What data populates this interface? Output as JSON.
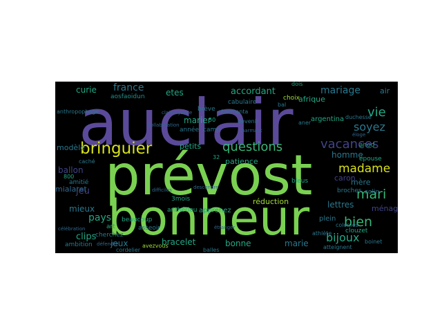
{
  "colors": {
    "background": "#000000",
    "page": "#ffffff",
    "palette": [
      "#5b4a9a",
      "#7ad151",
      "#d8e219",
      "#2a788e",
      "#22a884",
      "#414487",
      "#35b779",
      "#31688e",
      "#440154",
      "#3b528b",
      "#21918c",
      "#a0da39",
      "#fde725",
      "#482878"
    ]
  },
  "words": [
    {
      "text": "auclair",
      "color": "#5b4a9a"
    },
    {
      "text": "prévost",
      "color": "#7ad151"
    },
    {
      "text": "bonheur",
      "color": "#7ad151"
    },
    {
      "text": "bringuier",
      "color": "#d8e219"
    },
    {
      "text": "questions",
      "color": "#35b779"
    },
    {
      "text": "vacances",
      "color": "#414487"
    },
    {
      "text": "madame",
      "color": "#d8e219"
    },
    {
      "text": "mari",
      "color": "#35b779"
    },
    {
      "text": "bien",
      "color": "#35b779"
    },
    {
      "text": "bijoux",
      "color": "#22a884"
    },
    {
      "text": "vie",
      "color": "#22a884"
    },
    {
      "text": "soyez",
      "color": "#2a788e"
    },
    {
      "text": "mariage",
      "color": "#2a788e"
    },
    {
      "text": "france",
      "color": "#2a788e"
    },
    {
      "text": "accordant",
      "color": "#22a884"
    },
    {
      "text": "curie",
      "color": "#22a884"
    },
    {
      "text": "etes",
      "color": "#22a884"
    },
    {
      "text": "marier",
      "color": "#22a884"
    },
    {
      "text": "pays",
      "color": "#22a884"
    },
    {
      "text": "mieux",
      "color": "#2a788e"
    },
    {
      "text": "jeu",
      "color": "#414487"
    },
    {
      "text": "ballon",
      "color": "#414487"
    },
    {
      "text": "clips",
      "color": "#22a884"
    },
    {
      "text": "jeux",
      "color": "#2a788e"
    },
    {
      "text": "bracelet",
      "color": "#22a884"
    },
    {
      "text": "bonne",
      "color": "#22a884"
    },
    {
      "text": "marie",
      "color": "#2a788e"
    },
    {
      "text": "lettres",
      "color": "#2a788e"
    },
    {
      "text": "homme",
      "color": "#2a788e"
    },
    {
      "text": "caron",
      "color": "#414487"
    },
    {
      "text": "mère",
      "color": "#2a788e"
    },
    {
      "text": "ménage",
      "color": "#414487"
    },
    {
      "text": "mialaret",
      "color": "#31688e"
    },
    {
      "text": "modèle",
      "color": "#2a788e"
    },
    {
      "text": "petits",
      "color": "#22a884"
    },
    {
      "text": "patience",
      "color": "#22a884"
    },
    {
      "text": "réduction",
      "color": "#a0da39"
    },
    {
      "text": "apprenez",
      "color": "#22a884"
    },
    {
      "text": "plein",
      "color": "#2a788e"
    },
    {
      "text": "argentina",
      "color": "#22a884"
    },
    {
      "text": "afrique",
      "color": "#22a884"
    },
    {
      "text": "air",
      "color": "#2a788e"
    },
    {
      "text": "aosfaoidun",
      "color": "#21918c"
    },
    {
      "text": "choix",
      "color": "#a0da39"
    },
    {
      "text": "anod",
      "color": "#22a884"
    },
    {
      "text": "épouse",
      "color": "#22a884"
    },
    {
      "text": "art",
      "color": "#22a884"
    },
    {
      "text": "ambition",
      "color": "#2a788e"
    },
    {
      "text": "amitié",
      "color": "#2a788e"
    },
    {
      "text": "3mois",
      "color": "#22a884"
    },
    {
      "text": "anthérieu",
      "color": "#22a884"
    },
    {
      "text": "beaucoup",
      "color": "#22a884"
    },
    {
      "text": "année",
      "color": "#2a788e"
    },
    {
      "text": "camp",
      "color": "#2a788e"
    },
    {
      "text": "brève",
      "color": "#2a788e"
    },
    {
      "text": "cabulaire",
      "color": "#2a788e"
    },
    {
      "text": "bleus",
      "color": "#22a884"
    },
    {
      "text": "broches",
      "color": "#2a788e"
    },
    {
      "text": "clouzet",
      "color": "#22a884"
    },
    {
      "text": "colin",
      "color": "#2a788e"
    },
    {
      "text": "cherchez",
      "color": "#2a788e"
    },
    {
      "text": "asseoir",
      "color": "#2a788e"
    },
    {
      "text": "avezvous",
      "color": "#a0da39"
    },
    {
      "text": "balles",
      "color": "#2a788e"
    },
    {
      "text": "cordelier",
      "color": "#2a788e"
    },
    {
      "text": "atteignent",
      "color": "#2a788e"
    },
    {
      "text": "boinet",
      "color": "#2a788e"
    },
    {
      "text": "athlète",
      "color": "#2a788e"
    },
    {
      "text": "50",
      "color": "#22a884"
    },
    {
      "text": "32",
      "color": "#22a884"
    },
    {
      "text": "800",
      "color": "#22a884"
    },
    {
      "text": "anthropophage",
      "color": "#2a788e"
    },
    {
      "text": "charmanta",
      "color": "#2a788e"
    },
    {
      "text": "dois",
      "color": "#22a884"
    },
    {
      "text": "bal",
      "color": "#2a788e"
    },
    {
      "text": "devenir",
      "color": "#2a788e"
    },
    {
      "text": "aner",
      "color": "#2a788e"
    },
    {
      "text": "colonies",
      "color": "#2a788e"
    },
    {
      "text": "duchesse",
      "color": "#2a788e"
    },
    {
      "text": "collaboration",
      "color": "#31688e"
    },
    {
      "text": "clairvoyance",
      "color": "#31688e"
    },
    {
      "text": "difficiles",
      "color": "#31688e"
    },
    {
      "text": "descendre",
      "color": "#31688e"
    },
    {
      "text": "étranger",
      "color": "#31688e"
    },
    {
      "text": "caché",
      "color": "#2a788e"
    },
    {
      "text": "célébration",
      "color": "#31688e"
    },
    {
      "text": "défendre",
      "color": "#31688e"
    },
    {
      "text": "charmant",
      "color": "#31688e"
    },
    {
      "text": "éloge",
      "color": "#31688e"
    }
  ]
}
